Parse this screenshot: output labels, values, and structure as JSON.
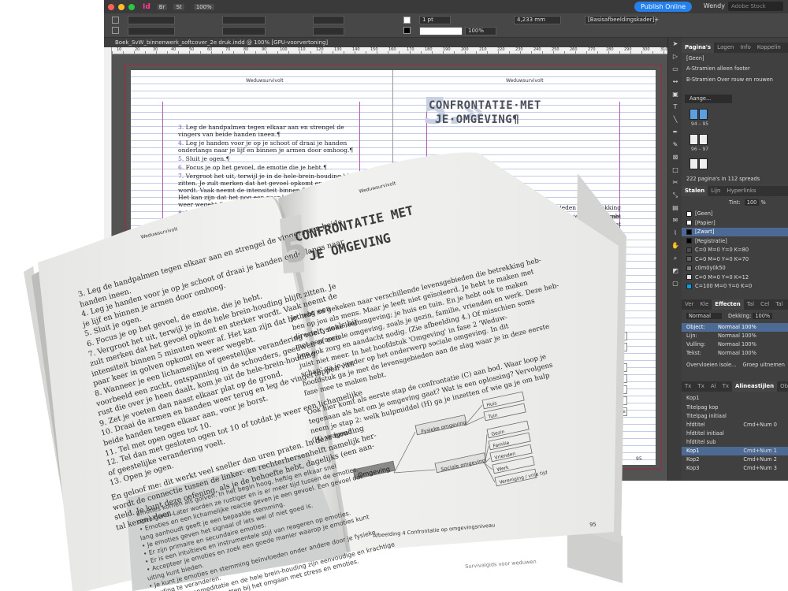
{
  "app": {
    "window_controls": [
      "close",
      "minimize",
      "maximize"
    ],
    "icon": "Id",
    "bridge": "Br",
    "stock": "St",
    "zoom": "100%",
    "publish_label": "Publish Online",
    "user": "Wendy",
    "stock_search_placeholder": "Adobe Stock"
  },
  "control": {
    "stroke_weight": "1 pt",
    "width_value": "4,233 mm",
    "object_style": "[Basisafbeeldingskader]+",
    "opacity": "100%"
  },
  "doc": {
    "tab_title": "Boek_SvW_binnenwerk_softcover_2e druk.indd @ 100% [GPU-voorvertoning]",
    "ruler": [
      "10",
      "20",
      "30",
      "40",
      "50",
      "60",
      "70",
      "80",
      "90",
      "100",
      "110",
      "120",
      "130",
      "140",
      "150",
      "160",
      "170",
      "180",
      "190",
      "200",
      "210",
      "220",
      "230",
      "240",
      "250",
      "260",
      "270",
      "280",
      "290",
      "300",
      "310"
    ],
    "header_left": "Weduwsurvivolt",
    "header_right": "Weduwsurvivolt",
    "left_items": [
      {
        "num": "3.",
        "text": "Leg de handpalmen tegen elkaar aan en strengel de vingers van beide handen ineen.¶"
      },
      {
        "num": "4.",
        "text": "Leg je handen voor je op je schoot of draai je handen onderlangs naar je lijf en binnen je armen door omhoog.¶"
      },
      {
        "num": "5.",
        "text": "Sluit je ogen.¶"
      },
      {
        "num": "6.",
        "text": "Focus je op het gevoel, de emotie die je hebt.¶"
      },
      {
        "num": "7.",
        "text": "Vergroot het uit, terwijl je in de hele-brein-houding blijft zitten. Je zult merken dat het gevoel opkomt en sterker wordt. Vaak neemt de intensiteit binnen 5 minuten weer af. Het kan zijn dat het nog een paar keer in golven opkomt en weer wegebt.¶"
      },
      {
        "num": "8.",
        "text": "Wanneer je een lichamelijke of geestelijke verandering..."
      }
    ],
    "chapter_num": "5.»",
    "chapter_title_1": "CONFRONTATIE·MET",
    "chapter_title_2": "JE·OMGEVING¶",
    "right_text": [
      "schillende levensgebieden die betrekking heb-",
      "en is het geliefd. Je hebt je te maken met",
      "huis en tuin. En je hebt ook te maken met",
      "familie, vrienden en werk. Deze heb-",
      "(Zie afbeelding 4.) Of misschien soms",
      "dstuk 'Omgeving' in fase 2 'Weduw-",
      "onderwerp sociale omgeving. In dit",
      "n de slag waar je in deze verste",
      "",
      "(C) aan bod. Waar loop je",
      "een oplossing? Vervolgens",
      "inzetten of wie ga je om hulp"
    ],
    "diagram_labels": [
      "Huis",
      "Tuin",
      "Gezin",
      "Familie",
      "Vrienden",
      "Werk",
      "vereniging / vrije tijd"
    ],
    "page_number_right": "95"
  },
  "panels": {
    "pages_tabs": [
      "Pagina's",
      "Lagen",
      "Info",
      "Koppelin"
    ],
    "master_none": "[Geen]",
    "masters": [
      "A-Stramien alleen footer",
      "B-Stramien Over rouw en rouwen"
    ],
    "page_search": "Aange...",
    "thumb_labels": [
      "94 – 95",
      "96 – 97"
    ],
    "pages_status": "222 pagina's in 112 spreads",
    "swatch_tabs": [
      "Stalen",
      "Lijn",
      "Hyperlinks"
    ],
    "tint_label": "Tint:",
    "tint_value": "100",
    "tint_unit": "%",
    "swatches": [
      {
        "name": "[Geen]",
        "color": "#ffffff"
      },
      {
        "name": "[Papier]",
        "color": "#ffffff"
      },
      {
        "name": "[Zwart]",
        "color": "#000000"
      },
      {
        "name": "[Registratie]",
        "color": "#000000"
      },
      {
        "name": "C=0 M=0 Y=0 K=80",
        "color": "#4d4d4d"
      },
      {
        "name": "C=0 M=0 Y=0 K=70",
        "color": "#666666"
      },
      {
        "name": "c0m0y0k50",
        "color": "#808080"
      },
      {
        "name": "C=0 M=0 Y=0 K=12",
        "color": "#e0e0e0"
      },
      {
        "name": "C=100 M=0 Y=0 K=0",
        "color": "#00a0e9"
      }
    ],
    "effects_tabs": [
      "Ver",
      "Kle",
      "Effecten",
      "Tal",
      "Cel",
      "Tal"
    ],
    "blend_mode": "Normaal",
    "opacity_label": "Dekking:",
    "opacity_value": "100%",
    "effect_rows": [
      {
        "label": "Object:",
        "value": "Normaal 100%"
      },
      {
        "label": "Lijn:",
        "value": "Normaal 100%"
      },
      {
        "label": "Vulling:",
        "value": "Normaal 100%"
      },
      {
        "label": "Tekst:",
        "value": "Normaal 100%"
      }
    ],
    "isolate_label": "Overvloeien isole...",
    "knockout_label": "Groep uitnemen",
    "para_tabs": [
      "Tx",
      "Tx",
      "Al",
      "Tx",
      "Alineastijlen",
      "Ob"
    ],
    "current_style": "Kop1",
    "para_styles": [
      {
        "name": "Titelpag kop",
        "shortcut": ""
      },
      {
        "name": "Titelpag initiaal",
        "shortcut": ""
      },
      {
        "name": "hfdtitel",
        "shortcut": "Cmd+Num 0"
      },
      {
        "name": "hfdtitel initiaal",
        "shortcut": ""
      },
      {
        "name": "hfdtitel sub",
        "shortcut": ""
      },
      {
        "name": "Kop1",
        "shortcut": "Cmd+Num 1"
      },
      {
        "name": "Kop2",
        "shortcut": "Cmd+Num 2"
      },
      {
        "name": "Kop3",
        "shortcut": "Cmd+Num 3"
      }
    ]
  },
  "book": {
    "header_left": "Weduwsurvivolt",
    "header_right": "Weduwsurvivolt",
    "left_lines": [
      "3.  Leg de handpalmen tegen elkaar aan en strengel de vingers van beide",
      "     handen ineen.",
      "4.  Leg je handen voor je op je schoot of draai je handen onderlangs naar",
      "     je lijf en binnen je armen door omhoog.",
      "5.  Sluit je ogen.",
      "6.  Focus je op het gevoel, de emotie, die je hebt.",
      "7.  Vergroot het uit, terwijl je in de hele brein-houding blijft zitten. Je",
      "     zult merken dat het gevoel opkomt en sterker wordt. Vaak neemt de",
      "     intensiteit binnen 5 minuten weer af. Het kan zijn dat het nog een",
      "     paar keer in golven opkomt en weer wegebt.",
      "8.  Wanneer je een lichamelijke of geestelijke verandering voelt, zoals bij-",
      "     voorbeeld een zucht, ontspanning in de schouders, geeuwen of een",
      "     rust die over je heen daalt, kom je uit de hele-brein-houding.",
      "9.  Zet je voeten dan naast elkaar plat op de grond.",
      "10. Draai de armen en handen weer terug en leg de vingertoppen van",
      "     beide handen tegen elkaar aan, voor je borst.",
      "11. Tel met open ogen tot 10.",
      "12. Tel dan met gesloten ogen tot 10 of totdat je weer een lichamelijke",
      "     of geestelijke verandering voelt.",
      "13. Open je ogen.",
      "En geloof me: dit werkt veel sneller dan uren praten. In deze houding",
      "wordt de connectie tussen de linker- en rechterhersenhelft namelijk her-",
      "steld. Je kunt deze oefening, als je de behoefte hebt, dagelijks (een aan-",
      "tal keren) doen."
    ],
    "tip_lines": [
      "Emoties komen als golven. In het begin hoog, heftig en elkaar snel",
      "opvolgend. Later worden ze rustiger en is er meer tijd tussen de emoties.",
      "• Emoties en een lichamelijke reactie geven je een gevoel. Een gevoel dat",
      "  lang aanhoudt geeft je een bepaalde stemming.",
      "• Je emoties geven het signaal of iets wel of niet goed is.",
      "• Er zijn primaire en secundaire emoties.",
      "• Er is een intuïtieve en instrumentele stijl van reageren op emoties.",
      "• Accepteer je emoties en zoek een goede manier waarop je emoties kunt",
      "  uiting kunt bieden.",
      "• Je kunt je emoties en stemming beïnvloeden onder andere door je fysieke",
      "  houding te veranderen.",
      "• Je kunt hersenmeditatie en de hele brein-houding zijn eenvoudige en krachtige",
      "  middelen die je kunt inzetten bij het omgaan met stress en emoties."
    ],
    "chapter_num": "5.",
    "chapter_title_1": "CONFRONTATIE MET",
    "chapter_title_2": "JE OMGEVING",
    "right_lines": [
      "Je hebt nu gekeken naar verschillende levensgebieden die betrekking heb-",
      "ben op jou als mens. Maar je leeft niet geïsoleerd. Je hebt te maken met",
      "directe fysieke leefomgeving; je huis en tuin. En je hebt ook te maken",
      "met een sociale omgeving, zoals je gezin, familie, vrienden en werk. Deze heb-",
      "ben ook zorg en aandacht nodig. (Zie afbeelding 4.) Of misschien soms",
      "juist niet meer. In het hoofdstuk 'Omgeving' in fase 2 'Weduw-",
      "schap' ga je verder op het onderwerp sociale omgeving. In dit",
      "hoofdstuk ga je met de levensgebieden aan de slag waar je in deze eerste",
      "fase mee te maken hebt.",
      "",
      "Ook hier komt als eerste stap de confrontatie (C) aan bod. Waar loop je",
      "tegenaan als het om je omgeving gaat? Wat is een oplossing? Vervolgens",
      "neem je stap 2: welk hulpmiddel (H) ga je inzetten of wie ga je om hulp",
      "(H) vragen?"
    ],
    "diagram": {
      "root": "Omgeving",
      "branches": [
        "Fysieke omgeving",
        "Sociale omgeving"
      ],
      "leaves": [
        "Huis",
        "Tuin",
        "Gezin",
        "Familie",
        "Vrienden",
        "Werk",
        "Vereniging / vrije tijd"
      ]
    },
    "caption": "Afbeelding 4  Confrontatie op omgevingsniveau",
    "footer_right": "Survivalgids voor weduwen",
    "page_number_right": "95"
  }
}
